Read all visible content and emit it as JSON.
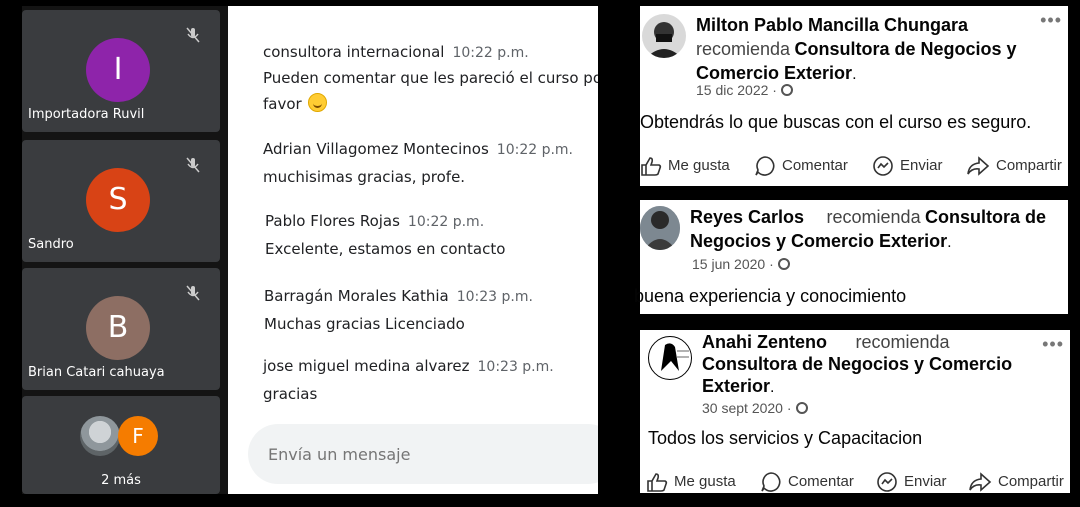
{
  "meet": {
    "participants": [
      {
        "initial": "I",
        "name": "Importadora Ruvil",
        "color": "#8e24aa"
      },
      {
        "initial": "S",
        "name": "Sandro",
        "color": "#d84315"
      },
      {
        "initial": "B",
        "name": "Brian Catari cahuaya",
        "color": "#8d6e63"
      }
    ],
    "more": {
      "initial": "F",
      "label": "2 más"
    },
    "chat": [
      {
        "sender": "consultora internacional",
        "time": "10:22 p.m.",
        "text1": "Pueden comentar que les pareció el curso por",
        "text2": "favor"
      },
      {
        "sender": "Adrian Villagomez Montecinos",
        "time": "10:22 p.m.",
        "text1": "muchisimas gracias, profe."
      },
      {
        "sender": "Pablo Flores Rojas",
        "time": "10:22 p.m.",
        "text1": "Excelente, estamos en contacto"
      },
      {
        "sender": "Barragán Morales Kathia",
        "time": "10:23 p.m.",
        "text1": "Muchas gracias Licenciado"
      },
      {
        "sender": "jose miguel medina alvarez",
        "time": "10:23 p.m.",
        "text1": "gracias"
      }
    ],
    "input_placeholder": "Envía un mensaje"
  },
  "reviews": [
    {
      "author": "Milton Pablo Mancilla Chungara",
      "recommends": "recomienda",
      "page": "Consultora de Negocios y Comercio Exterior",
      "date": "15 dic 2022",
      "text": "Obtendrás lo que buscas con el curso es seguro."
    },
    {
      "author": "Reyes Carlos",
      "recommends": "recomienda",
      "page": "Consultora de Negocios y Comercio Exterior",
      "date": "15 jun 2020",
      "text": "buena experiencia y conocimiento"
    },
    {
      "author": "Anahi Zenteno",
      "recommends": "recomienda",
      "page": "Consultora de Negocios y Comercio Exterior",
      "date": "30 sept 2020",
      "text": "Todos los servicios y Capacitacion"
    }
  ],
  "actions": {
    "like": "Me gusta",
    "comment": "Comentar",
    "send": "Enviar",
    "share": "Compartir"
  },
  "more_options": "•••",
  "period": ".",
  "dot_separator": "·"
}
